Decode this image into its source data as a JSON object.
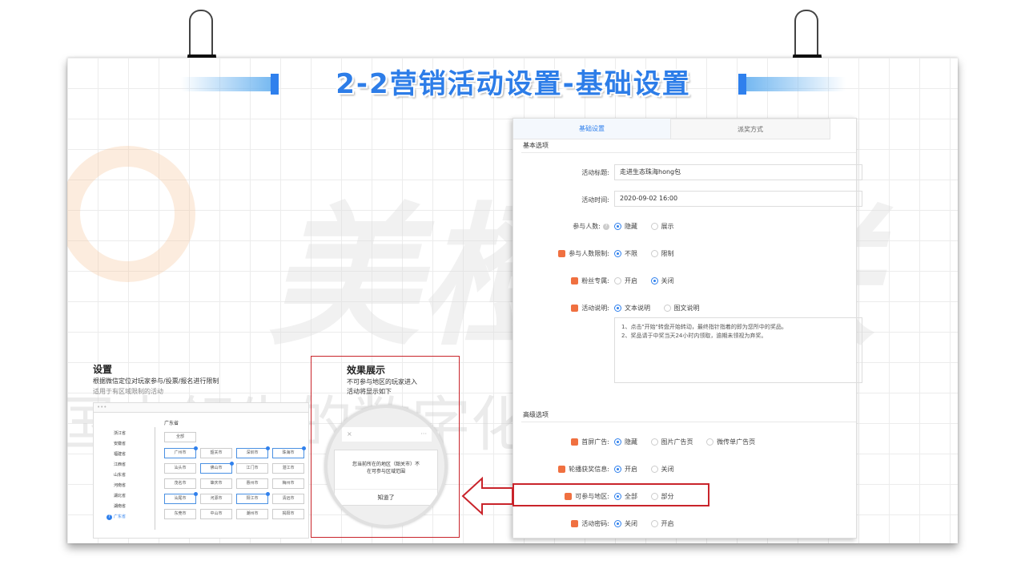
{
  "title": "2-2营销活动设置-基础设置",
  "watermark": {
    "brand": "美橙互联",
    "slogan": "国内领先的数字化营销服务商"
  },
  "settings_panel": {
    "tabs": [
      "基础设置",
      "派奖方式"
    ],
    "basic_section": "基本选项",
    "fields": {
      "title_label": "活动标题:",
      "title_value": "走进生态珠海hong包",
      "time_label": "活动时间:",
      "time_value": "2020-09-02 16:00",
      "participants_label": "参与人数:",
      "participants_options": [
        "隐藏",
        "展示"
      ],
      "limit_label": "参与人数限制:",
      "limit_options": [
        "不限",
        "限制"
      ],
      "fans_label": "粉丝专属:",
      "fans_options": [
        "开启",
        "关闭"
      ],
      "desc_label": "活动说明:",
      "desc_options": [
        "文本说明",
        "图文说明"
      ],
      "desc_text_1": "1、点击\"开始\"转盘开始转动，最终指针指着的即为您所中的奖品。",
      "desc_text_2": "2、奖品请于中奖当天24小时内领取，逾期未领视为弃奖。"
    },
    "advanced_section": "高级选项",
    "advanced": {
      "ad_label": "首屏广告:",
      "ad_options": [
        "隐藏",
        "图片广告页",
        "微传单广告页"
      ],
      "carousel_label": "轮播获奖信息:",
      "carousel_options": [
        "开启",
        "关闭"
      ],
      "region_label": "可参与地区:",
      "region_options": [
        "全部",
        "部分"
      ],
      "password_label": "活动密码:",
      "password_options": [
        "关闭",
        "开启"
      ]
    }
  },
  "left_section": {
    "heading": "设置",
    "desc1": "根据微信定位对玩家参与/投票/报名进行限制",
    "desc2": "适用于有区域限制的活动",
    "province_header": "广东省",
    "all_button": "全部",
    "provinces": [
      "浙江省",
      "安徽省",
      "福建省",
      "江西省",
      "山东省",
      "河南省",
      "湖北省",
      "湖南省",
      "广东省"
    ],
    "active_province_badge": "7",
    "cities": [
      "广州市",
      "韶关市",
      "深圳市",
      "珠海市",
      "汕头市",
      "佛山市",
      "江门市",
      "湛江市",
      "茂名市",
      "肇庆市",
      "惠州市",
      "梅州市",
      "汕尾市",
      "河源市",
      "阳江市",
      "清远市",
      "东莞市",
      "中山市",
      "潮州市",
      "揭阳市"
    ],
    "selected_cities": [
      0,
      2,
      3,
      5,
      12,
      14
    ]
  },
  "effect": {
    "heading": "效果展示",
    "desc1": "不可参与地区的玩家进入",
    "desc2": "活动将显示如下",
    "dialog_text1": "您当前所在的地区（韶关市）不",
    "dialog_text2": "在可参与区域范围",
    "dialog_button": "知道了",
    "close_symbol": "×",
    "more_symbol": "···"
  },
  "colors": {
    "accent": "#2f80ed",
    "highlight": "#c9242b",
    "icon": "#f07040"
  }
}
